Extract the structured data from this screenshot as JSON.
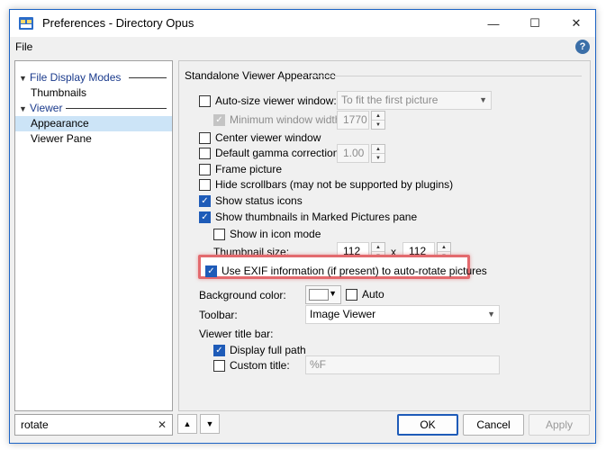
{
  "window": {
    "title": "Preferences - Directory Opus",
    "minimize_glyph": "—",
    "maximize_glyph": "☐",
    "close_glyph": "✕"
  },
  "menu": {
    "file": "File",
    "help_glyph": "?"
  },
  "tree": {
    "categories": [
      {
        "label": "File Display Modes",
        "items": [
          {
            "label": "Thumbnails",
            "selected": false
          }
        ]
      },
      {
        "label": "Viewer",
        "items": [
          {
            "label": "Appearance",
            "selected": true
          },
          {
            "label": "Viewer Pane",
            "selected": false
          }
        ]
      }
    ]
  },
  "panel": {
    "group_title": "Standalone Viewer Appearance",
    "auto_size": {
      "label": "Auto-size viewer window:",
      "checked": false,
      "value": "To fit the first picture"
    },
    "min_width": {
      "label": "Minimum window width:",
      "checked": true,
      "disabled": true,
      "value": "1770"
    },
    "center": {
      "label": "Center viewer window",
      "checked": false
    },
    "gamma": {
      "label": "Default gamma correction:",
      "checked": false,
      "value": "1.00"
    },
    "frame": {
      "label": "Frame picture",
      "checked": false
    },
    "hide_scrollbars": {
      "label": "Hide scrollbars (may not be supported by plugins)",
      "checked": false
    },
    "status_icons": {
      "label": "Show status icons",
      "checked": true
    },
    "show_thumbs": {
      "label": "Show thumbnails in Marked Pictures pane",
      "checked": true
    },
    "icon_mode": {
      "label": "Show in icon mode",
      "checked": false
    },
    "thumb_size": {
      "label": "Thumbnail size:",
      "width": "112",
      "separator": "x",
      "height": "112"
    },
    "exif": {
      "label": "Use EXIF information (if present) to auto-rotate pictures",
      "checked": true
    },
    "background": {
      "label": "Background color:",
      "swatch": "#ffffff",
      "auto_label": "Auto",
      "auto_checked": false
    },
    "toolbar": {
      "label": "Toolbar:",
      "value": "Image Viewer"
    },
    "title_bar": {
      "label": "Viewer title bar:",
      "full_path": {
        "label": "Display full path",
        "checked": true
      },
      "custom": {
        "label": "Custom title:",
        "checked": false,
        "value": "%F"
      }
    }
  },
  "bottom": {
    "search_value": "rotate",
    "search_clear_glyph": "✕",
    "up_glyph": "▲",
    "down_glyph": "▼",
    "ok": "OK",
    "cancel": "Cancel",
    "apply": "Apply"
  },
  "colors": {
    "accent": "#1e5bb8",
    "highlight_border": "#e36a6e",
    "tree_category": "#1a3a8c",
    "selection": "#cce4f7"
  }
}
